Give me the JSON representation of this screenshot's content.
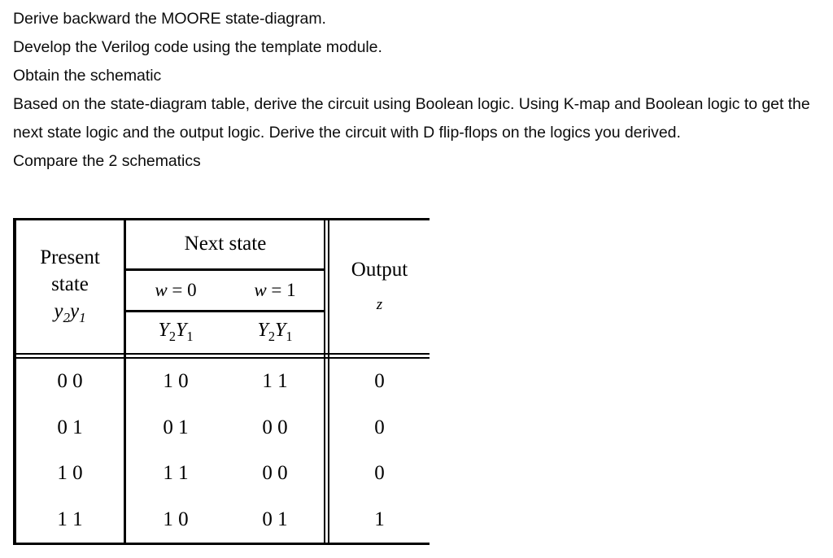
{
  "instructions": {
    "lines": [
      "Derive backward the MOORE state-diagram.",
      "Develop the Verilog code using the template module.",
      "Obtain the schematic"
    ],
    "paragraph": "Based on the state-diagram table, derive the circuit using Boolean logic. Using K-map and Boolean logic to get the next state logic and the output logic. Derive the circuit with D flip-flops on the logics you derived.",
    "closing": "Compare the 2 schematics"
  },
  "table": {
    "headers": {
      "present_state_line1": "Present",
      "present_state_line2": "state",
      "present_state_vars": "y",
      "present_state_sub1": "2",
      "present_state_var2": "y",
      "present_state_sub2": "1",
      "next_state": "Next state",
      "w0_var": "w",
      "w0_eq": " = ",
      "w0_val": "0",
      "w1_var": "w",
      "w1_eq": " = ",
      "w1_val": "1",
      "Y_col0": "Y",
      "Y_col0_sub1": "2",
      "Y_col0_var2": "Y",
      "Y_col0_sub2": "1",
      "Y_col1": "Y",
      "Y_col1_sub1": "2",
      "Y_col1_var2": "Y",
      "Y_col1_sub2": "1",
      "output": "Output",
      "output_symbol": "z"
    },
    "rows": [
      {
        "present": "0 0",
        "w0": "1 0",
        "w1": "1 1",
        "out": "0"
      },
      {
        "present": "0 1",
        "w0": "0 1",
        "w1": "0 0",
        "out": "0"
      },
      {
        "present": "1 0",
        "w0": "1 1",
        "w1": "0 0",
        "out": "0"
      },
      {
        "present": "1 1",
        "w0": "1 0",
        "w1": "0 1",
        "out": "1"
      }
    ]
  },
  "colors": {
    "text": "#0d0d0d",
    "rule": "#000000",
    "background": "#ffffff"
  }
}
